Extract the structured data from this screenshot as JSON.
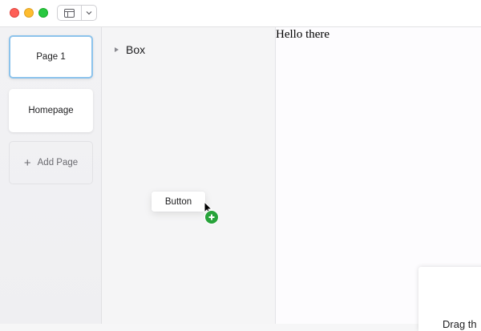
{
  "window": {
    "controls": [
      "close",
      "minimize",
      "maximize"
    ],
    "toolbar": {
      "layout_icon": "sidebar-layout-icon",
      "dropdown_icon": "chevron-down-icon"
    }
  },
  "pages": {
    "items": [
      {
        "label": "Page 1",
        "selected": true
      },
      {
        "label": "Homepage",
        "selected": false
      }
    ],
    "add_label": "Add Page"
  },
  "layers": {
    "items": [
      {
        "label": "Box",
        "expanded": false
      }
    ]
  },
  "drag": {
    "label": "Button",
    "badge_icon": "plus-icon"
  },
  "canvas": {
    "text": "Hello there",
    "card_text": "Drag th"
  },
  "colors": {
    "selected_border": "#8cc3ec",
    "add_badge": "#27a33a",
    "close": "#fe5f57",
    "minimize": "#febc2e",
    "maximize": "#28c840"
  }
}
